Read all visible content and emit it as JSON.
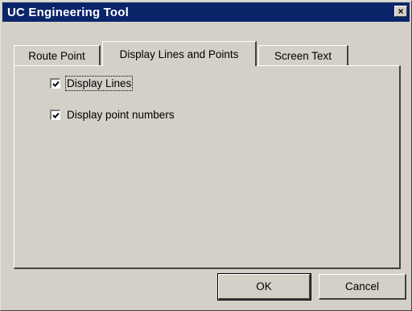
{
  "window": {
    "title": "UC Engineering Tool",
    "close_glyph": "×",
    "close_icon": "close-icon"
  },
  "tabs": [
    {
      "label": "Route Point",
      "active": false
    },
    {
      "label": "Display Lines and Points",
      "active": true
    },
    {
      "label": "Screen Text",
      "active": false
    }
  ],
  "options": [
    {
      "label": "Display Lines",
      "checked": true
    },
    {
      "label": "Display point numbers",
      "checked": true
    }
  ],
  "buttons": {
    "ok_label": "OK",
    "cancel_label": "Cancel"
  },
  "colors": {
    "titlebar": "#0a246a",
    "face": "#d4d0c8"
  }
}
